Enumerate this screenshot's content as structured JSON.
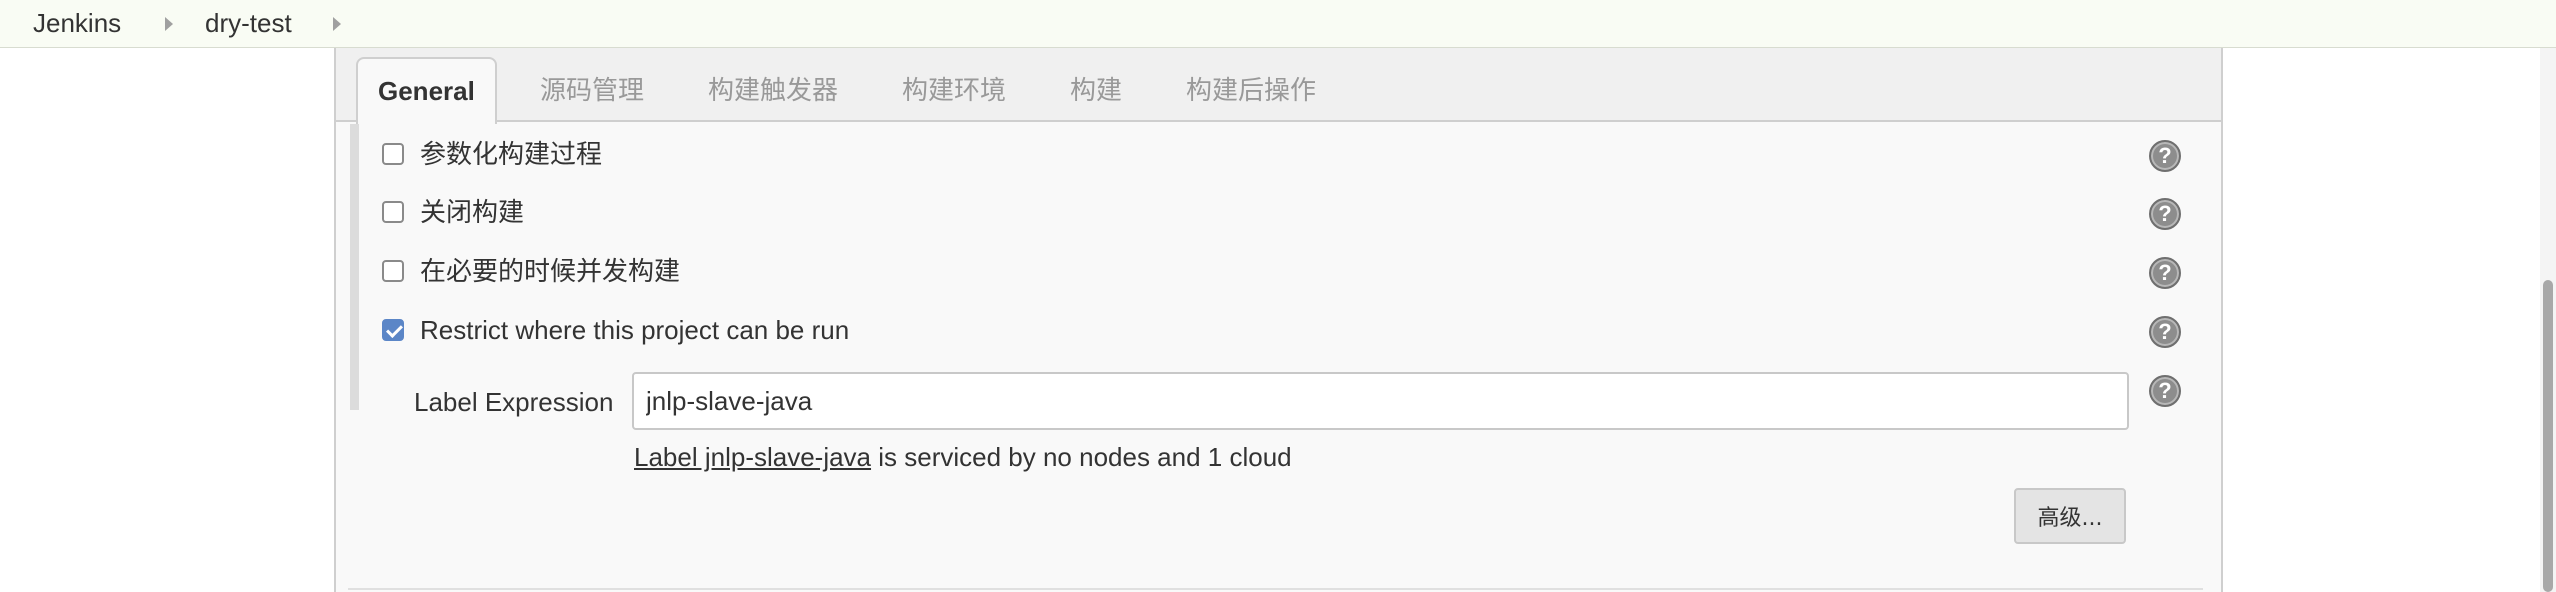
{
  "breadcrumb": {
    "items": [
      {
        "label": "Jenkins"
      },
      {
        "label": "dry-test"
      }
    ]
  },
  "tabs": [
    {
      "label": "General",
      "active": true
    },
    {
      "label": "源码管理",
      "active": false
    },
    {
      "label": "构建触发器",
      "active": false
    },
    {
      "label": "构建环境",
      "active": false
    },
    {
      "label": "构建",
      "active": false
    },
    {
      "label": "构建后操作",
      "active": false
    }
  ],
  "options": [
    {
      "label": "参数化构建过程",
      "checked": false
    },
    {
      "label": "关闭构建",
      "checked": false
    },
    {
      "label": "在必要的时候并发构建",
      "checked": false
    },
    {
      "label": "Restrict where this project can be run",
      "checked": true
    }
  ],
  "label_expression": {
    "label": "Label Expression",
    "value": "jnlp-slave-java",
    "status_link": "Label jnlp-slave-java",
    "status_text": " is serviced by no nodes and 1 cloud"
  },
  "advanced_button": {
    "label": "高级..."
  },
  "help_icon": {
    "glyph": "?"
  },
  "colors": {
    "breadcrumb_bg": "#f9fcf4",
    "panel_bg": "#f9f9f9",
    "tab_bar_bg": "#f0f0f0",
    "checkbox_checked": "#5b86c7",
    "help_icon": "#8d8d8d"
  }
}
